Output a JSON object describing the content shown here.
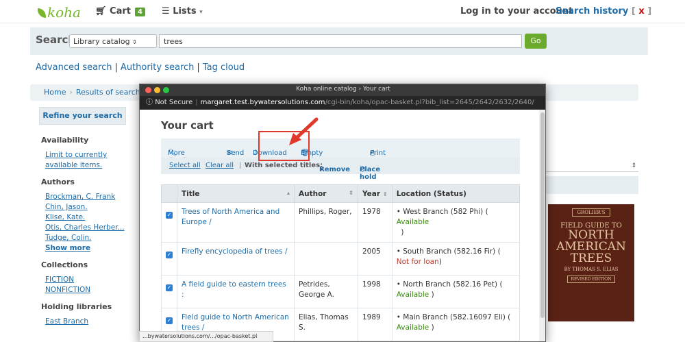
{
  "nav": {
    "logo": "koha",
    "cart_label": "Cart",
    "cart_count": "4",
    "lists_label": "Lists",
    "login": "Log in to your account",
    "search_history": "Search history",
    "search_history_x": "x"
  },
  "search": {
    "label": "Search",
    "scope": "Library catalog",
    "query": "trees",
    "go": "Go"
  },
  "links": {
    "advanced": "Advanced search",
    "authority": "Authority search",
    "tagcloud": "Tag cloud"
  },
  "breadcrumbs": {
    "home": "Home",
    "results": "Results of search for"
  },
  "sidebar": {
    "refine": "Refine your search",
    "availability_title": "Availability",
    "availability_link": "Limit to currently available items.",
    "authors_title": "Authors",
    "authors": [
      "Brockman, C. Frank",
      "Chin, Jason.",
      "Klise, Kate.",
      "Otis, Charles Herber...",
      "Tudge, Colin."
    ],
    "show_more": "Show more",
    "collections_title": "Collections",
    "collections": [
      "FICTION",
      "NONFICTION"
    ],
    "holding_title": "Holding libraries",
    "holding": [
      "East Branch"
    ]
  },
  "book_cover": {
    "publisher": "GROLIER'S",
    "line1": "FIELD GUIDE TO",
    "line2": "NORTH",
    "line3": "AMERICAN",
    "line4": "TREES",
    "author": "BY THOMAS S. ELIAS",
    "edition": "REVISED EDITION"
  },
  "status_url": "...bywatersolutions.com/.../opac-basket.pl",
  "modal": {
    "window_title": "Koha online catalog › Your cart",
    "not_secure": "Not Secure",
    "url_host": "margaret.test.bywatersolutions.com",
    "url_path": "/cgi-bin/koha/opac-basket.pl?bib_list=2645/2642/2632/2640/",
    "cart_title": "Your cart",
    "toolbar": {
      "more_details": "More details",
      "send": "Send",
      "download": "Download",
      "empty_close": "Empty and close",
      "print": "Print"
    },
    "selbar": {
      "select_all": "Select all",
      "clear_all": "Clear all",
      "with_selected": "With selected titles:",
      "remove": "Remove",
      "place_hold": "Place hold"
    },
    "columns": {
      "title": "Title",
      "author": "Author",
      "year": "Year",
      "location": "Location (Status)"
    },
    "rows": [
      {
        "title": "Trees of North America and Europe /",
        "author": "Phillips, Roger,",
        "year": "1978",
        "location": "West Branch (582 Phi) (",
        "status": "Available",
        "status_class": "avail",
        "tail": ")"
      },
      {
        "title": "Firefly encyclopedia of trees /",
        "author": "",
        "year": "2005",
        "location": "South Branch (582.16 Fir) (",
        "status": "Not for loan",
        "status_class": "notavail",
        "tail": ")"
      },
      {
        "title": "A field guide to eastern trees :",
        "author": "Petrides, George A.",
        "year": "1998",
        "location": "North Branch (582.16 Pet) (",
        "status": "Available",
        "status_class": "avail",
        "tail": ")"
      },
      {
        "title": "Field guide to North American trees /",
        "author": "Elias, Thomas S.",
        "year": "1989",
        "location": "Main Branch (582.16097 Eli) (",
        "status": "Available",
        "status_class": "avail",
        "tail": ")"
      }
    ]
  }
}
